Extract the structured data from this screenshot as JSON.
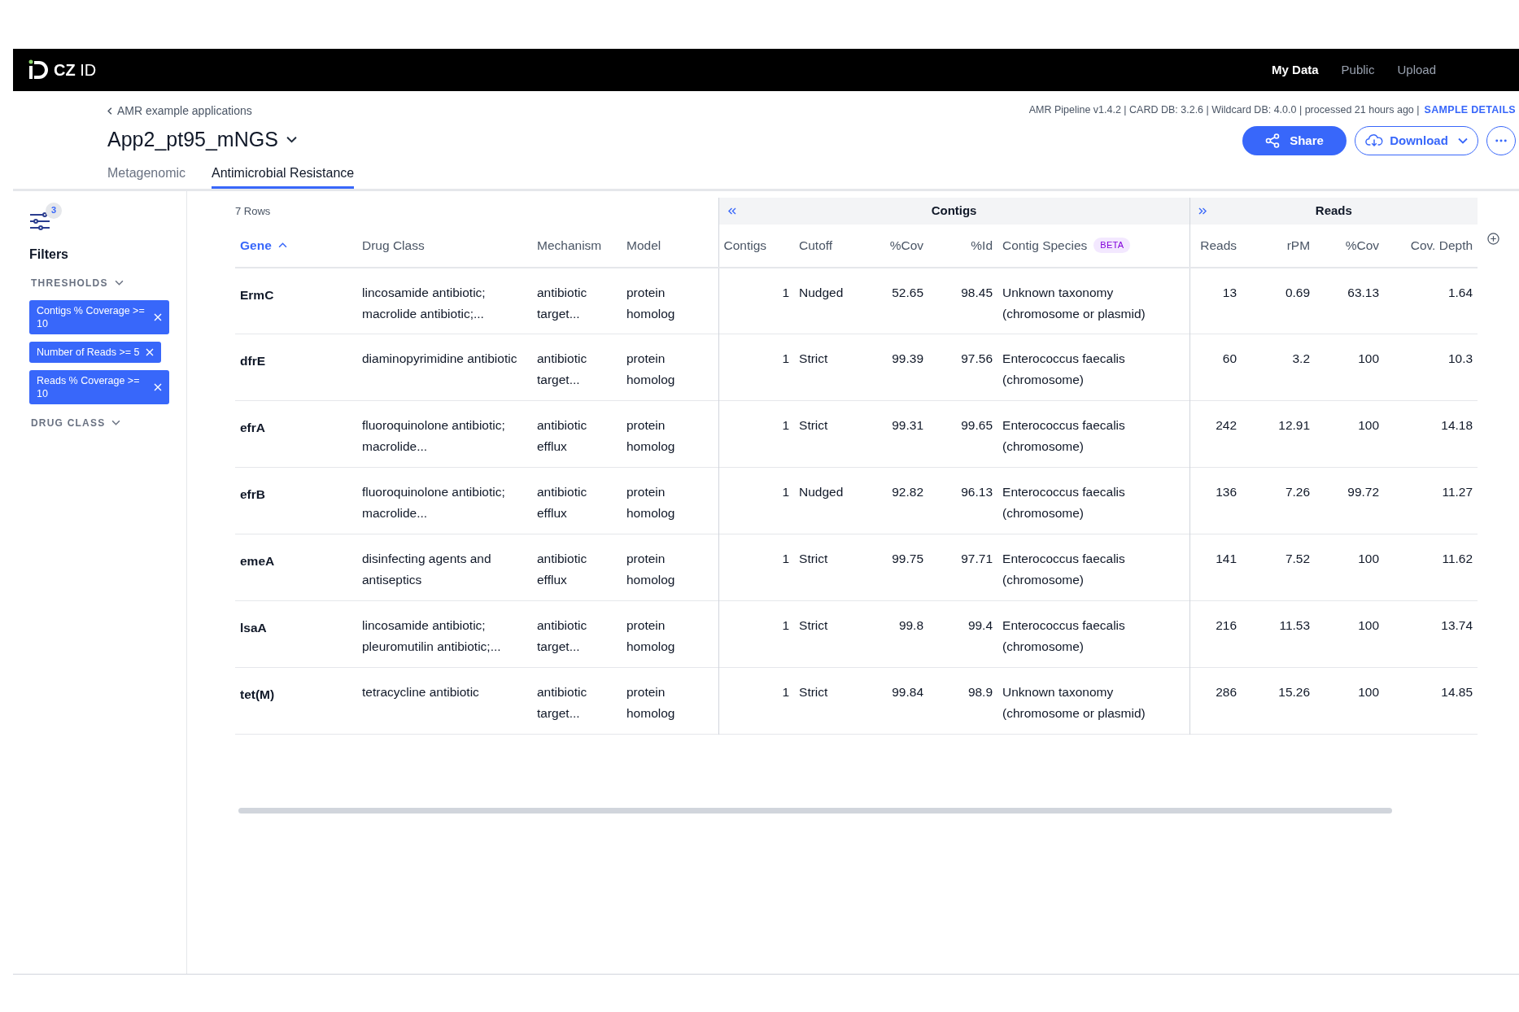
{
  "navbar": {
    "logo": "**CZ** ID",
    "links": [
      {
        "label": "My Data",
        "selected": true
      },
      {
        "label": "Public",
        "selected": false
      },
      {
        "label": "Upload",
        "selected": false
      }
    ]
  },
  "breadcrumb": "AMR example applications",
  "sample_title": "App2_pt95_mNGS",
  "pipeline_info": "AMR Pipeline v1.4.2 | CARD DB: 3.2.6 | Wildcard DB: 4.0.0 | processed 21 hours ago |",
  "sample_details": "SAMPLE DETAILS",
  "buttons": {
    "share": "Share",
    "download": "Download"
  },
  "tabs": [
    {
      "label": "Metagenomic",
      "selected": false
    },
    {
      "label": "Antimicrobial Resistance",
      "selected": true
    }
  ],
  "filters": {
    "count": "3",
    "title": "Filters",
    "sections": [
      {
        "label": "THRESHOLDS",
        "chips": [
          "Contigs % Coverage >= 10",
          "Number of Reads >= 5",
          "Reads % Coverage >= 10"
        ]
      },
      {
        "label": "DRUG CLASS"
      }
    ]
  },
  "table": {
    "row_count": "7 Rows",
    "groups": [
      {
        "label": "Contigs"
      },
      {
        "label": "Reads"
      }
    ],
    "columns": [
      {
        "label": "Gene",
        "kind": "text",
        "sorted": true
      },
      {
        "label": "Drug Class",
        "kind": "text",
        "sorted": false
      },
      {
        "label": "Mechanism",
        "kind": "text",
        "sorted": false
      },
      {
        "label": "Model",
        "kind": "text",
        "sorted": false
      },
      {
        "label": "Contigs",
        "kind": "number",
        "sorted": false
      },
      {
        "label": "Cutoff",
        "kind": "text",
        "sorted": false
      },
      {
        "label": "%Cov",
        "kind": "number",
        "sorted": false
      },
      {
        "label": "%Id",
        "kind": "number",
        "sorted": false
      },
      {
        "label": "Contig Species",
        "kind": "text",
        "sorted": false,
        "badge": "BETA"
      },
      {
        "label": "Reads",
        "kind": "number",
        "sorted": false
      },
      {
        "label": "rPM",
        "kind": "number",
        "sorted": false
      },
      {
        "label": "%Cov",
        "kind": "number",
        "sorted": false
      },
      {
        "label": "Cov. Depth",
        "kind": "number",
        "sorted": false
      }
    ],
    "rows": [
      [
        "ErmC",
        "lincosamide antibiotic; macrolide antibiotic;...",
        "antibiotic target...",
        "protein homolog",
        "1",
        "Nudged",
        "52.65",
        "98.45",
        "Unknown taxonomy (chromosome or plasmid)",
        "13",
        "0.69",
        "63.13",
        "1.64"
      ],
      [
        "dfrE",
        "diaminopyrimidine antibiotic",
        "antibiotic target...",
        "protein homolog",
        "1",
        "Strict",
        "99.39",
        "97.56",
        "Enterococcus faecalis (chromosome)",
        "60",
        "3.2",
        "100",
        "10.3"
      ],
      [
        "efrA",
        "fluoroquinolone antibiotic; macrolide...",
        "antibiotic efflux",
        "protein homolog",
        "1",
        "Strict",
        "99.31",
        "99.65",
        "Enterococcus faecalis (chromosome)",
        "242",
        "12.91",
        "100",
        "14.18"
      ],
      [
        "efrB",
        "fluoroquinolone antibiotic; macrolide...",
        "antibiotic efflux",
        "protein homolog",
        "1",
        "Nudged",
        "92.82",
        "96.13",
        "Enterococcus faecalis (chromosome)",
        "136",
        "7.26",
        "99.72",
        "11.27"
      ],
      [
        "emeA",
        "disinfecting agents and antiseptics",
        "antibiotic efflux",
        "protein homolog",
        "1",
        "Strict",
        "99.75",
        "97.71",
        "Enterococcus faecalis (chromosome)",
        "141",
        "7.52",
        "100",
        "11.62"
      ],
      [
        "lsaA",
        "lincosamide antibiotic; pleuromutilin antibiotic;...",
        "antibiotic target...",
        "protein homolog",
        "1",
        "Strict",
        "99.8",
        "99.4",
        "Enterococcus faecalis (chromosome)",
        "216",
        "11.53",
        "100",
        "13.74"
      ],
      [
        "tet(M)",
        "tetracycline antibiotic",
        "antibiotic target...",
        "protein homolog",
        "1",
        "Strict",
        "99.84",
        "98.9",
        "Unknown taxonomy (chromosome or plasmid)",
        "286",
        "15.26",
        "100",
        "14.85"
      ]
    ]
  }
}
